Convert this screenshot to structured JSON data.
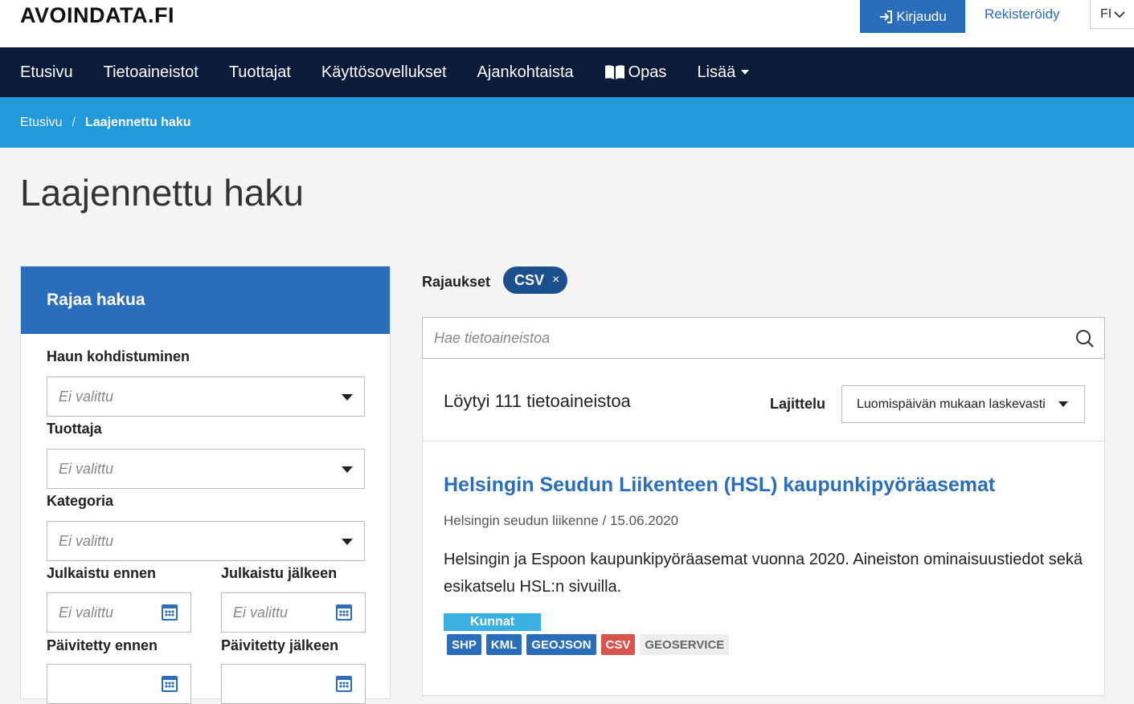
{
  "header": {
    "logo": "AVOINDATA.FI",
    "login_label": "Kirjaudu",
    "register_label": "Rekisteröidy",
    "language": "FI"
  },
  "nav": {
    "items": [
      {
        "label": "Etusivu"
      },
      {
        "label": "Tietoaineistot"
      },
      {
        "label": "Tuottajat"
      },
      {
        "label": "Käyttösovellukset"
      },
      {
        "label": "Ajankohtaista"
      },
      {
        "label": "Opas",
        "icon": "book-icon"
      },
      {
        "label": "Lisää",
        "icon": "caret-down-icon"
      }
    ]
  },
  "breadcrumb": {
    "home": "Etusivu",
    "separator": "/",
    "current": "Laajennettu haku"
  },
  "page": {
    "title": "Laajennettu haku"
  },
  "filters": {
    "header": "Rajaa hakua",
    "target_label": "Haun kohdistuminen",
    "target_value": "Ei valittu",
    "producer_label": "Tuottaja",
    "producer_value": "Ei valittu",
    "category_label": "Kategoria",
    "category_value": "Ei valittu",
    "published_before_label": "Julkaistu ennen",
    "published_before_value": "Ei valittu",
    "published_after_label": "Julkaistu jälkeen",
    "published_after_value": "Ei valittu",
    "updated_before_label": "Päivitetty ennen",
    "updated_after_label": "Päivitetty jälkeen"
  },
  "active_filters": {
    "label": "Rajaukset",
    "chips": [
      {
        "label": "CSV",
        "remove": "×"
      }
    ]
  },
  "search": {
    "placeholder": "Hae tietoaineistoa"
  },
  "results": {
    "count_text": "Löytyi 111 tietoaineistoa",
    "sort_label": "Lajittelu",
    "sort_value": "Luomispäivän mukaan laskevasti",
    "items": [
      {
        "title": "Helsingin Seudun Liikenteen (HSL) kaupunkipyöräasemat",
        "publisher": "Helsingin seudun liikenne",
        "date": "/ 15.06.2020",
        "description": "Helsingin ja Espoon kaupunkipyöräasemat vuonna 2020. Aineiston ominaisuustiedot sekä esikatselu HSL:n sivuilla.",
        "category": "Kunnat",
        "formats": [
          {
            "label": "SHP",
            "color": "#2a6ebb"
          },
          {
            "label": "KML",
            "color": "#2a6ebb"
          },
          {
            "label": "GEOJSON",
            "color": "#2a6ebb"
          },
          {
            "label": "CSV",
            "color": "#d9534f"
          },
          {
            "label": "GEOSERVICE",
            "color": "#eeeeee"
          }
        ]
      }
    ]
  },
  "colors": {
    "nav_bg": "#0c1b3a",
    "breadcrumb_bg": "#2299d8",
    "primary": "#2a6ebb",
    "chip_bg": "#1b4f8e",
    "category_badge": "#3ab1e0"
  }
}
